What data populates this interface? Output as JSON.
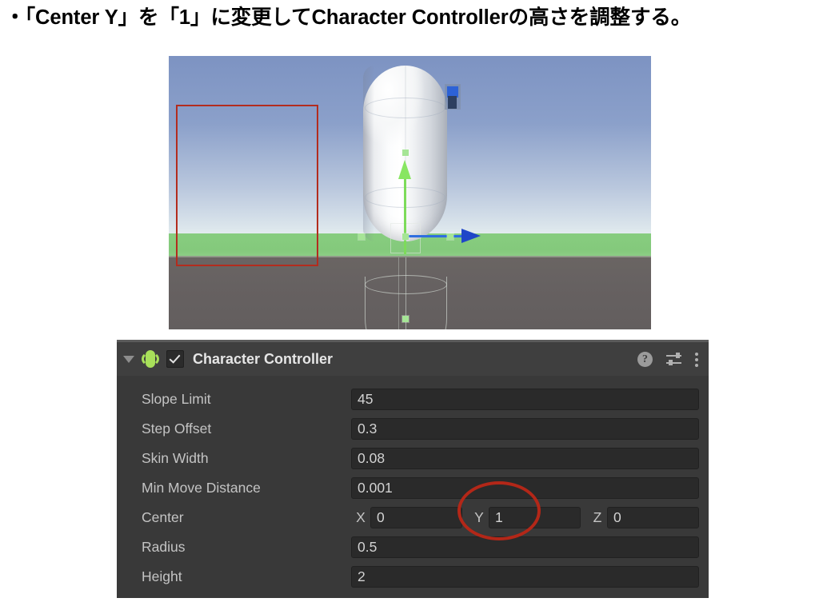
{
  "caption": {
    "text": "・「Center Y」を「1」に変更してCharacter Controllerの高さを調整する。"
  },
  "viewport": {
    "name": "unity-scene-view",
    "sky_color": "#8ba0ca",
    "grass_color": "#85cc7e",
    "floor_color": "#656060",
    "gizmo": {
      "y_axis_color": "#7ddb5a",
      "x_axis_color": "#2f6ee0",
      "handle_color": "#a6e596"
    },
    "camera_icon": {
      "lens_color": "#2d62d6",
      "body_color": "#2d3f60"
    },
    "annotation_rect_color": "#b32c1e"
  },
  "inspector": {
    "header": {
      "foldout_icon": "triangle-down-icon",
      "component_icon": "character-controller-icon",
      "enabled": true,
      "title": "Character Controller",
      "help_label": "?",
      "help_icon": "help-icon",
      "preset_icon": "preset-sliders-icon",
      "menu_icon": "kebab-menu-icon"
    },
    "properties": [
      {
        "label": "Slope Limit",
        "type": "single",
        "value": "45"
      },
      {
        "label": "Step Offset",
        "type": "single",
        "value": "0.3"
      },
      {
        "label": "Skin Width",
        "type": "single",
        "value": "0.08"
      },
      {
        "label": "Min Move Distance",
        "type": "single",
        "value": "0.001"
      },
      {
        "label": "Center",
        "type": "vector3",
        "axes": [
          "X",
          "Y",
          "Z"
        ],
        "values": [
          "0",
          "1",
          "0"
        ]
      },
      {
        "label": "Radius",
        "type": "single",
        "value": "0.5"
      },
      {
        "label": "Height",
        "type": "single",
        "value": "2"
      }
    ],
    "background_color": "#393939",
    "field_color": "#2a2a2a",
    "annotation_ellipse_color": "#b32718",
    "annotation_target": "Center Y"
  }
}
